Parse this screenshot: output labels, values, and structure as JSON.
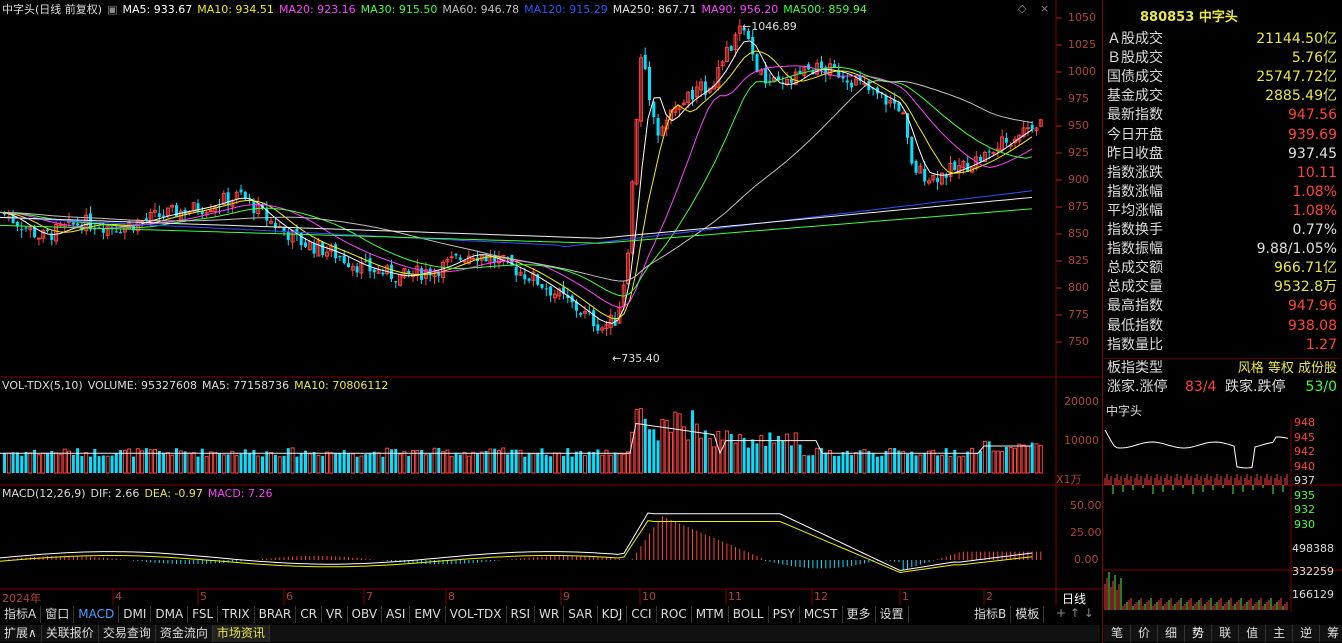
{
  "stock": {
    "title": "中字头(日线 前复权)",
    "code": "880853",
    "name": "中字头"
  },
  "ma_legend": [
    {
      "label": "MA5: 933.67",
      "color": "#ffffff"
    },
    {
      "label": "MA10: 934.51",
      "color": "#f0f000"
    },
    {
      "label": "MA20: 923.16",
      "color": "#ff40ff"
    },
    {
      "label": "MA30: 915.50",
      "color": "#40ff40"
    },
    {
      "label": "MA60: 946.78",
      "color": "#c0c0c0"
    },
    {
      "label": "MA120: 915.29",
      "color": "#3050ff"
    },
    {
      "label": "MA250: 867.71",
      "color": "#e0e0e0"
    },
    {
      "label": "MA90: 956.20",
      "color": "#ff40ff"
    },
    {
      "label": "MA500: 859.94",
      "color": "#40ff40"
    }
  ],
  "price_axis": [
    "1050",
    "1025",
    "1000",
    "975",
    "950",
    "925",
    "900",
    "875",
    "850",
    "825",
    "800",
    "775",
    "750"
  ],
  "annotations": {
    "high": "1046.89",
    "low": "735.40"
  },
  "vol": {
    "title": "VOL-TDX(5,10)",
    "volume": "VOLUME: 95327608",
    "ma5": "MA5: 77158736",
    "ma10": "MA10: 70806112",
    "axis": [
      "20000",
      "10000"
    ],
    "unit": "X1万"
  },
  "macd": {
    "title": "MACD(12,26,9)",
    "dif": "DIF: 2.66",
    "dea": "DEA: -0.97",
    "macd": "MACD: 7.26",
    "axis": [
      "50.00",
      "25.00",
      "0.00"
    ]
  },
  "dates": [
    "2024年",
    "4",
    "5",
    "6",
    "7",
    "8",
    "9",
    "10",
    "11",
    "12",
    "1",
    "2"
  ],
  "right_panel": {
    "rows": [
      {
        "k": "Ａ股成交",
        "v": "21144.50亿",
        "c": "#e8e840"
      },
      {
        "k": "Ｂ股成交",
        "v": "5.76亿",
        "c": "#e8e840"
      },
      {
        "k": "国债成交",
        "v": "25747.72亿",
        "c": "#e8e840"
      },
      {
        "k": "基金成交",
        "v": "2885.49亿",
        "c": "#e8e840"
      },
      {
        "k": "最新指数",
        "v": "947.56",
        "c": "#ff4040"
      },
      {
        "k": "今日开盘",
        "v": "939.69",
        "c": "#ff4040"
      },
      {
        "k": "昨日收盘",
        "v": "937.45",
        "c": "#e0e0e0"
      },
      {
        "k": "指数涨跌",
        "v": "10.11",
        "c": "#ff4040"
      },
      {
        "k": "指数涨幅",
        "v": "1.08%",
        "c": "#ff4040"
      },
      {
        "k": "平均涨幅",
        "v": "1.08%",
        "c": "#ff4040"
      },
      {
        "k": "指数换手",
        "v": "0.77%",
        "c": "#e0e0e0"
      },
      {
        "k": "指数振幅",
        "v": "9.88/1.05%",
        "c": "#e0e0e0"
      },
      {
        "k": "总成交额",
        "v": "966.71亿",
        "c": "#e8e840"
      },
      {
        "k": "总成交量",
        "v": "9532.8万",
        "c": "#e8e840"
      },
      {
        "k": "最高指数",
        "v": "947.96",
        "c": "#ff4040"
      },
      {
        "k": "最低指数",
        "v": "938.08",
        "c": "#ff4040"
      },
      {
        "k": "指数量比",
        "v": "1.27",
        "c": "#ff4040"
      }
    ],
    "board_type_label": "板指类型",
    "board_type_value": "风格 等权 成份股",
    "up_label": "涨家.涨停",
    "up_value": "83/4",
    "down_label": "跌家.跌停",
    "down_value": "53/0",
    "mini_title": "中字头",
    "mini_price_axis": [
      "948",
      "945",
      "942",
      "940",
      "937",
      "935",
      "932",
      "930"
    ],
    "mini_vol_axis": [
      "498388",
      "332259",
      "166129"
    ]
  },
  "bottom_tabs": [
    "指标A",
    "窗口",
    "MACD",
    "DMI",
    "DMA",
    "FSL",
    "TRIX",
    "BRAR",
    "CR",
    "VR",
    "OBV",
    "ASI",
    "EMV",
    "VOL-TDX",
    "RSI",
    "WR",
    "SAR",
    "KDJ",
    "CCI",
    "ROC",
    "MTM",
    "BOLL",
    "PSY",
    "MCST",
    "更多",
    "设置"
  ],
  "bottom_right_tabs": [
    "指标B",
    "模板"
  ],
  "bottom_bar": [
    "扩展∧",
    "关联报价",
    "交易查询",
    "资金流向",
    "市场资讯"
  ],
  "right_bottom_tabs": [
    "笔",
    "价",
    "细",
    "势",
    "联",
    "值",
    "主",
    "逆",
    "筹"
  ],
  "period": "日线",
  "colors": {
    "up": "#ff4040",
    "down": "#00e0ff",
    "axis": "#b02020",
    "accent_yellow": "#e8e840"
  }
}
